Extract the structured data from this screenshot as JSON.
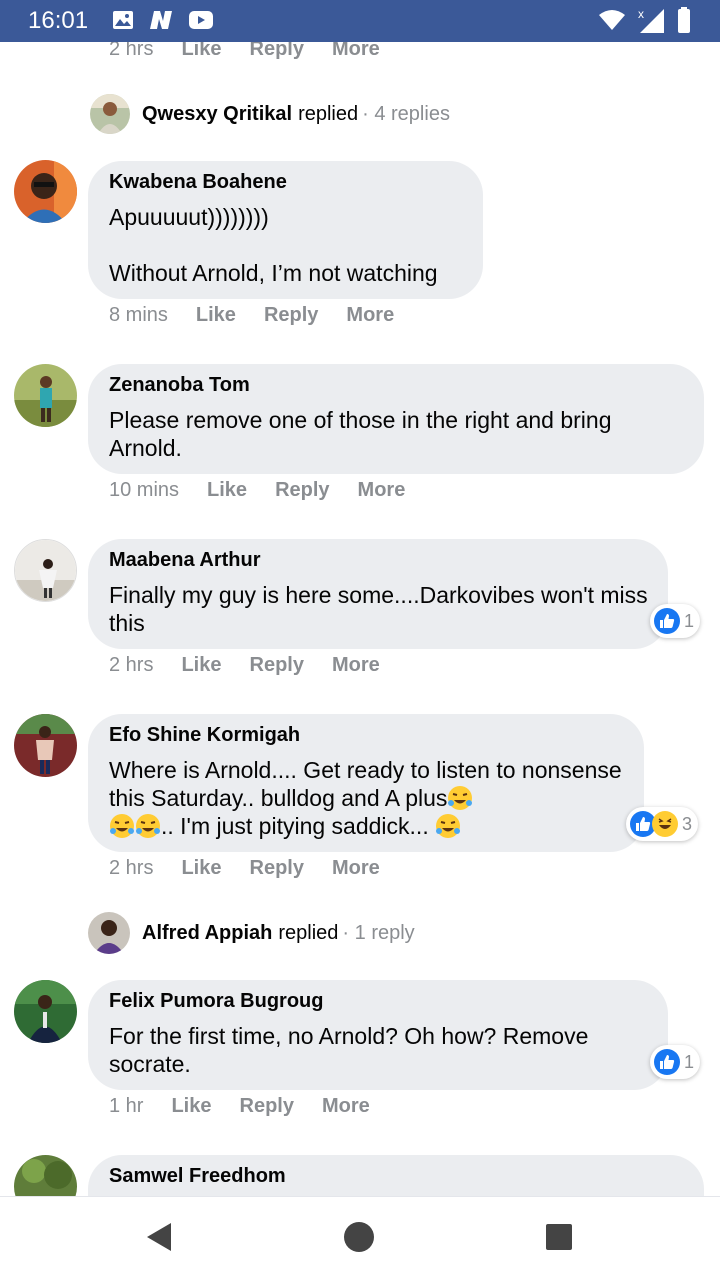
{
  "status_bar": {
    "time": "16:01",
    "left_icons": [
      "gallery-icon",
      "n-app-icon",
      "youtube-icon"
    ],
    "right_icons": [
      "wifi-icon",
      "signal-icon",
      "battery-icon"
    ],
    "color": "#3b5998"
  },
  "top_actions": {
    "time": "2 hrs",
    "like": "Like",
    "reply": "Reply",
    "more": "More"
  },
  "reply_summary_1": {
    "name": "Qwesxy Qritikal",
    "verb": "replied",
    "count": "· 4 replies"
  },
  "comments": [
    {
      "author": "Kwabena Boahene",
      "text": "Apuuuuut))))))))\n\nWithout Arnold, I’m not watching",
      "time": "8 mins",
      "like": "Like",
      "reply": "Reply",
      "more": "More"
    },
    {
      "author": "Zenanoba Tom",
      "text": "Please remove one of those in the right and bring Arnold.",
      "time": "10 mins",
      "like": "Like",
      "reply": "Reply",
      "more": "More"
    },
    {
      "author": "Maabena Arthur",
      "text": "Finally my guy is here some....Darkovibes won't miss this",
      "time": "2 hrs",
      "like": "Like",
      "reply": "Reply",
      "more": "More",
      "reaction_count": "1"
    },
    {
      "author": "Efo Shine Kormigah",
      "text_a": "Where is Arnold.... Get ready to listen to nonsense this Saturday.. bulldog and A plus",
      "text_b": ".. I'm just pitying saddick... ",
      "time": "2 hrs",
      "like": "Like",
      "reply": "Reply",
      "more": "More",
      "reaction_count": "3"
    },
    {
      "author": "Felix Pumora Bugroug",
      "text": "For the first time, no Arnold? Oh how? Remove socrate.",
      "time": "1 hr",
      "like": "Like",
      "reply": "Reply",
      "more": "More",
      "reaction_count": "1"
    },
    {
      "author": "Samwel Freedhom"
    }
  ],
  "reply_summary_2": {
    "name": "Alfred Appiah",
    "verb": "replied",
    "count": "· 1 reply"
  },
  "nav": [
    "back-icon",
    "home-icon",
    "recents-icon"
  ],
  "colors": {
    "like_blue": "#1877f2",
    "bubble": "#ebedf0",
    "meta_gray": "#8a8d91"
  }
}
